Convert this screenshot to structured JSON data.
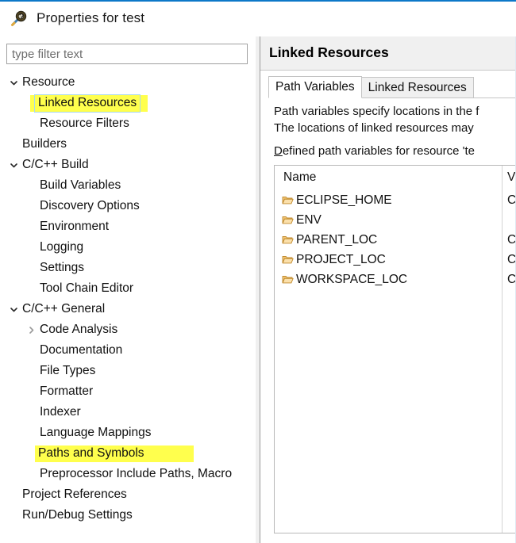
{
  "window": {
    "title": "Properties for test",
    "icon": "properties-magnifier-icon",
    "accent_color": "#0d78c8"
  },
  "filter": {
    "placeholder": "type filter text",
    "value": ""
  },
  "tree": {
    "items": [
      {
        "label": "Resource",
        "indent": 0,
        "twisty": "expanded",
        "highlight": "none"
      },
      {
        "label": "Linked Resources",
        "indent": 1,
        "twisty": "none",
        "highlight": "selected"
      },
      {
        "label": "Resource Filters",
        "indent": 1,
        "twisty": "none",
        "highlight": "none"
      },
      {
        "label": "Builders",
        "indent": 0,
        "twisty": "none",
        "highlight": "none"
      },
      {
        "label": "C/C++ Build",
        "indent": 0,
        "twisty": "expanded",
        "highlight": "none"
      },
      {
        "label": "Build Variables",
        "indent": 1,
        "twisty": "none",
        "highlight": "none"
      },
      {
        "label": "Discovery Options",
        "indent": 1,
        "twisty": "none",
        "highlight": "none"
      },
      {
        "label": "Environment",
        "indent": 1,
        "twisty": "none",
        "highlight": "none"
      },
      {
        "label": "Logging",
        "indent": 1,
        "twisty": "none",
        "highlight": "none"
      },
      {
        "label": "Settings",
        "indent": 1,
        "twisty": "none",
        "highlight": "none"
      },
      {
        "label": "Tool Chain Editor",
        "indent": 1,
        "twisty": "none",
        "highlight": "none"
      },
      {
        "label": "C/C++ General",
        "indent": 0,
        "twisty": "expanded",
        "highlight": "none"
      },
      {
        "label": "Code Analysis",
        "indent": 1,
        "twisty": "collapsed",
        "highlight": "none"
      },
      {
        "label": "Documentation",
        "indent": 1,
        "twisty": "none",
        "highlight": "none"
      },
      {
        "label": "File Types",
        "indent": 1,
        "twisty": "none",
        "highlight": "none"
      },
      {
        "label": "Formatter",
        "indent": 1,
        "twisty": "none",
        "highlight": "none"
      },
      {
        "label": "Indexer",
        "indent": 1,
        "twisty": "none",
        "highlight": "none"
      },
      {
        "label": "Language Mappings",
        "indent": 1,
        "twisty": "none",
        "highlight": "none"
      },
      {
        "label": "Paths and Symbols",
        "indent": 1,
        "twisty": "none",
        "highlight": "yellow"
      },
      {
        "label": "Preprocessor Include Paths, Macro",
        "indent": 1,
        "twisty": "none",
        "highlight": "none"
      },
      {
        "label": "Project References",
        "indent": 0,
        "twisty": "none",
        "highlight": "none"
      },
      {
        "label": "Run/Debug Settings",
        "indent": 0,
        "twisty": "none",
        "highlight": "none"
      }
    ],
    "highlight_color": "#ffff4d"
  },
  "page": {
    "title": "Linked Resources",
    "tabs": [
      {
        "label": "Path Variables",
        "selected": true
      },
      {
        "label": "Linked Resources",
        "selected": false
      }
    ],
    "description": {
      "line1": "Path variables specify locations in the f",
      "line2": "The locations of linked resources may",
      "line3_mnemonic": "D",
      "line3_rest": "efined path variables for resource 'te"
    },
    "table": {
      "columns": [
        "Name",
        "Va"
      ],
      "rows": [
        {
          "icon": "folder-icon",
          "name": "ECLIPSE_HOME",
          "value": "C:"
        },
        {
          "icon": "folder-icon",
          "name": "ENV",
          "value": ""
        },
        {
          "icon": "folder-icon",
          "name": "PARENT_LOC",
          "value": "C:"
        },
        {
          "icon": "folder-icon",
          "name": "PROJECT_LOC",
          "value": "C:"
        },
        {
          "icon": "folder-icon",
          "name": "WORKSPACE_LOC",
          "value": "C:"
        }
      ]
    }
  }
}
